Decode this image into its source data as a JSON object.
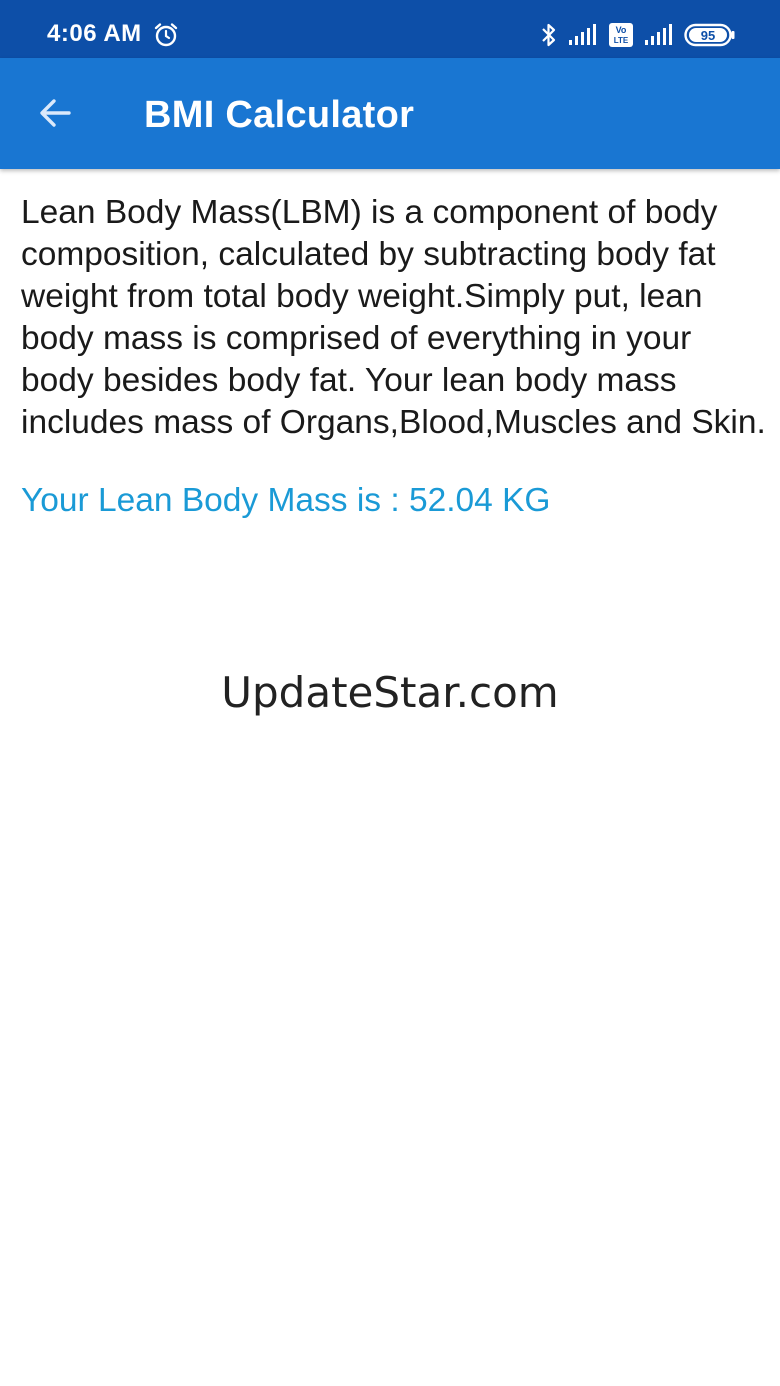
{
  "status_bar": {
    "time": "4:06 AM",
    "icons": [
      "alarm-icon",
      "bluetooth-icon",
      "signal-icon",
      "volte-icon",
      "signal-icon",
      "battery-icon"
    ],
    "volte_label_top": "Vo",
    "volte_label_bottom": "LTE",
    "battery_level": "95"
  },
  "app_bar": {
    "back_icon": "arrow-left-icon",
    "title": "BMI Calculator"
  },
  "content": {
    "description": "Lean Body Mass(LBM) is a component of body composition, calculated by subtracting body fat weight from total body weight.Simply put, lean body mass is comprised of everything in your body besides body fat. Your lean body mass includes mass of Organs,Blood,Muscles and Skin.",
    "result": "Your Lean Body Mass is : 52.04 KG"
  },
  "watermark": {
    "text": "UpdateStar.com"
  },
  "colors": {
    "status_bar": "#0d4fa8",
    "app_bar": "#1976d2",
    "result_text": "#1a9ad6"
  }
}
